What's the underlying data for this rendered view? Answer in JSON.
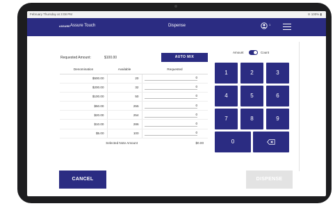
{
  "status_bar": {
    "left_text": "February Thursday at 3:08 PM",
    "right_text": "100%"
  },
  "header": {
    "brand": "ASSURE",
    "app_title": "Assure Touch",
    "screen_title": "Dispense",
    "profile_suffix": "1"
  },
  "requested": {
    "label": "Requested Amount:",
    "value": "$100.00"
  },
  "auto_mix_label": "AUTO MIX",
  "table": {
    "headers": [
      "Denomination",
      "Available",
      "Requested"
    ],
    "rows": [
      {
        "denomination": "$500.00",
        "available": "20",
        "requested": "0"
      },
      {
        "denomination": "$200.00",
        "available": "32",
        "requested": "0"
      },
      {
        "denomination": "$100.00",
        "available": "50",
        "requested": "0"
      },
      {
        "denomination": "$50.00",
        "available": "255",
        "requested": "0"
      },
      {
        "denomination": "$20.00",
        "available": "254",
        "requested": "0"
      },
      {
        "denomination": "$10.00",
        "available": "286",
        "requested": "0"
      },
      {
        "denomination": "$5.00",
        "available": "100",
        "requested": "0"
      }
    ],
    "total_label": "Selected Note Amount",
    "total_value": "$0.00"
  },
  "mode_toggle": {
    "left_label": "Amount",
    "right_label": "Count",
    "selected": "Count"
  },
  "keypad": {
    "keys": [
      "1",
      "2",
      "3",
      "4",
      "5",
      "6",
      "7",
      "8",
      "9"
    ],
    "zero": "0",
    "backspace_icon": "backspace-icon"
  },
  "cancel_label": "CANCEL",
  "dispense_label": "DISPENSE",
  "colors": {
    "primary": "#2b2c82",
    "disabled": "#e3e3e3"
  }
}
